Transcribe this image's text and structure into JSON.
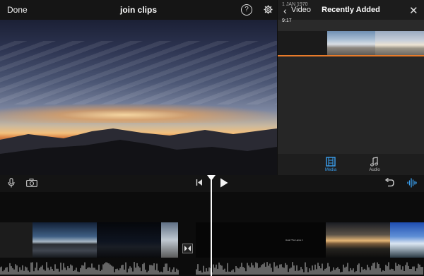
{
  "topbar": {
    "done_label": "Done",
    "project_title": "join clips",
    "help_glyph": "?",
    "icons": [
      "help-icon",
      "gear-icon"
    ]
  },
  "media_browser": {
    "back_label": "Video",
    "title": "Recently Added",
    "date_header": "1 JAN 1970",
    "clip_duration": "9:17",
    "tabs": [
      {
        "label": "Media",
        "icon": "film-icon",
        "active": true
      },
      {
        "label": "Audio",
        "icon": "music-note-icon",
        "active": false
      }
    ]
  },
  "timeline": {
    "title_card_text": "Heart The Lapse 1"
  },
  "colors": {
    "accent": "#3aa0f0",
    "clip_marker": "#e87b2a",
    "background": "#101010"
  }
}
